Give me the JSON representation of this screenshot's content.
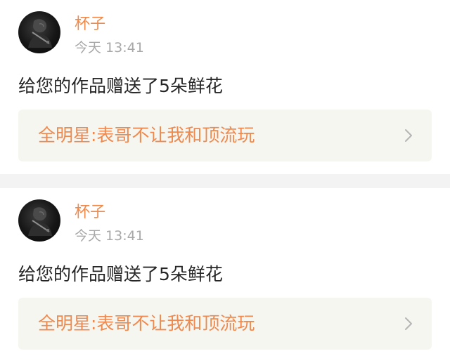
{
  "notifications": [
    {
      "avatar_icon": "user-avatar-icon",
      "username": "杯子",
      "time": "今天 13:41",
      "message": "给您的作品赠送了5朵鲜花",
      "work_title": "全明星:表哥不让我和顶流玩",
      "chevron_icon": "chevron-right-icon"
    },
    {
      "avatar_icon": "user-avatar-icon",
      "username": "杯子",
      "time": "今天 13:41",
      "message": "给您的作品赠送了5朵鲜花",
      "work_title": "全明星:表哥不让我和顶流玩",
      "chevron_icon": "chevron-right-icon"
    }
  ],
  "colors": {
    "accent": "#f08a4b",
    "card_bg": "#f6f6f1",
    "muted_text": "#a8a8a8",
    "body_text": "#262626",
    "divider": "#f3f3f3"
  }
}
